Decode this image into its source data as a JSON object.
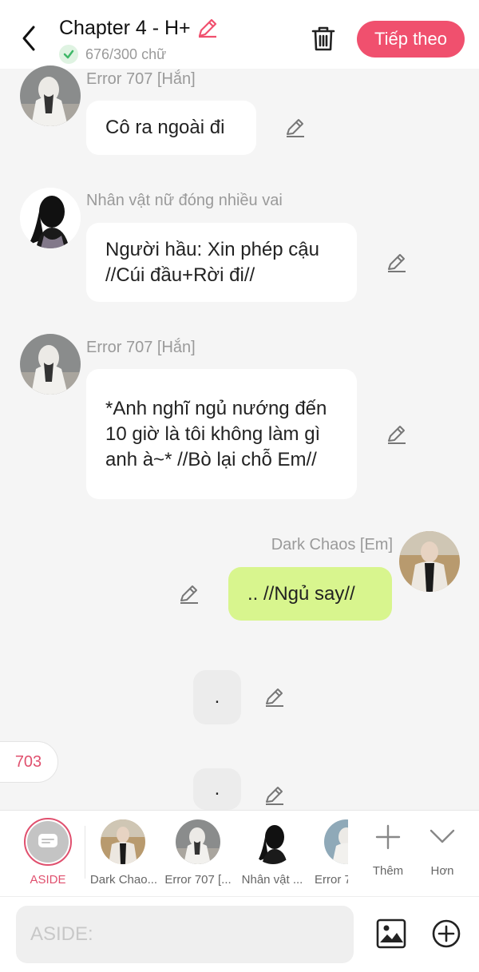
{
  "header": {
    "title": "Chapter 4 - H+",
    "word_count": "676/300 chữ",
    "next_label": "Tiếp theo"
  },
  "messages": [
    {
      "sender": "Error 707 [Hắn]",
      "text": "Cô ra ngoài đi"
    },
    {
      "sender": "Nhân vật nữ đóng nhiều vai",
      "text": "Người hầu: Xin phép cậu //Cúi đầu+Rời đi//"
    },
    {
      "sender": "Error 707 [Hắn]",
      "text": "*Anh nghĩ ngủ nướng đến 10 giờ là tôi không làm gì anh à~* //Bò lại chỗ Em//"
    },
    {
      "sender": "Dark Chaos [Em]",
      "text": ".. //Ngủ say//"
    },
    {
      "sender": "",
      "text": "."
    },
    {
      "sender": "",
      "text": "."
    }
  ],
  "badge_count": "703",
  "toolbar": {
    "items": [
      {
        "label": "ASIDE"
      },
      {
        "label": "Dark Chao..."
      },
      {
        "label": "Error 707 [..."
      },
      {
        "label": "Nhân vật ..."
      },
      {
        "label": "Error 7"
      },
      {
        "label": "Thêm"
      },
      {
        "label": "Hơn"
      }
    ]
  },
  "input": {
    "placeholder": "ASIDE:"
  },
  "colors": {
    "accent": "#f0506e",
    "green_bubble": "#d8f58e",
    "background": "#f5f5f5"
  }
}
